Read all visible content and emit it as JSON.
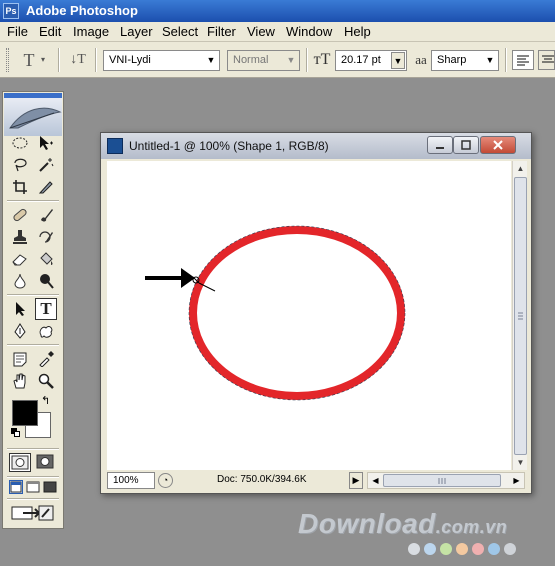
{
  "app": {
    "title": "Adobe Photoshop",
    "icon": "photoshop-app-icon"
  },
  "menu": {
    "items": [
      "File",
      "Edit",
      "Image",
      "Layer",
      "Select",
      "Filter",
      "View",
      "Window",
      "Help"
    ]
  },
  "options_bar": {
    "font_family": "VNI-Lydi",
    "font_style": "Normal",
    "font_size": "20.17 pt",
    "antialias": "Sharp",
    "antialias_icon_text": "aa"
  },
  "tools": {
    "active": "horizontal-type-tool",
    "foreground_color": "#000000",
    "background_color": "#ffffff"
  },
  "document": {
    "title": "Untitled-1 @ 100% (Shape 1, RGB/8)",
    "zoom": "100%",
    "doc_size": "Doc: 750.0K/394.6K",
    "shape_color": "#e3262a"
  },
  "watermark": {
    "text": "Download",
    "suffix": ".com.vn",
    "dot_colors": [
      "#d9dde2",
      "#bcd6ee",
      "#c5e3a5",
      "#f4c9a0",
      "#f0b0b0",
      "#9fc7e8",
      "#cfd3d8"
    ]
  }
}
